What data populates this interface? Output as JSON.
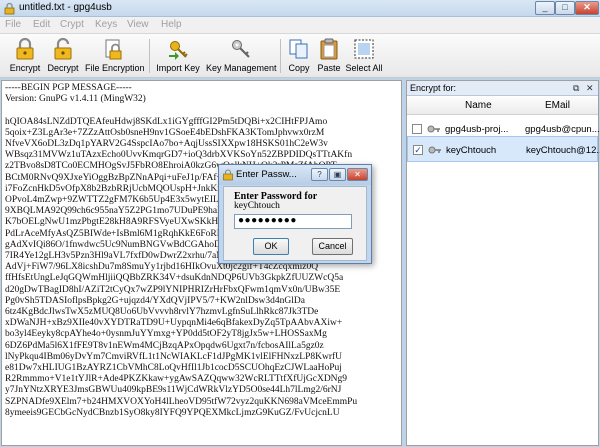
{
  "window": {
    "title": "untitled.txt - gpg4usb"
  },
  "menu": [
    "File",
    "Edit",
    "Crypt",
    "Keys",
    "View",
    "Help"
  ],
  "toolbar": {
    "encrypt": "Encrypt",
    "decrypt": "Decrypt",
    "file_encryption": "File Encryption",
    "import_key": "Import Key",
    "key_management": "Key Management",
    "copy": "Copy",
    "paste": "Paste",
    "select_all": "Select All"
  },
  "editor": {
    "lines": [
      "-----BEGIN PGP MESSAGE-----",
      "Version: GnuPG v1.4.11 (MingW32)",
      "",
      "hQIOA84sLNZdDTQEAfeuHdwj8SKdLx1iGYgfffGI2Pm5tDQBi+x2CIHtFPJAmo",
      "5qoix+Z3LgAr3e+7ZZzAttOsb0sneH9nv1GSoeE4bEDshFKA3KTomJphvwx0rzM",
      "NfveVX6oDL3zDq1pYARV2G4SspcIAo7bo+AqjUssSIXXpw18HSKS01hC2eW3v",
      "WBsqz31MVWz1uTAzxEcho0UvvKmqrGD7+ioQ3drbXVKSoYn52ZBPDIDQsTTtAKfn",
      "z2TBvo8sD8TCo0ECMHOgSvJ5FbRO8EhroiA0kzG6wOolkNH+Ok2rPMsZfAbQPT",
      "BCtM0RNvQ9XJxeYiOggBzBpZNnAPqi+uFeJ1p/FAf+M/YxHmHSJzhhrG6tvVKpI",
      "i7FoZcnHkD5vOfpX8b2BzbRRjUcbMQOUspH+JnkKrwVtpIEoc5Wfl2SiK9sr1mTS",
      "OPvoL4mZwp+9ZWTTZ2gFM7K6b5Up4E3x5wytEILS1sQqE5Dm0hkN3Yb1cRA",
      "9XBQLMA92Q99ch6c955naY5Z2PG1mo7UDuPE9haBHD05ri0Bja27VkFcRCs",
      "K7bOELgNwU1mzPbgtE28kH8A9RFSVyeUXwSKkHDE04PTn1T0nRfFmTXKNQ",
      "PdLrAceMfyAsQZ5BIWde+IsBml6M1gRqhKkE6FoRHrL5Jc8vNdmpN1hIfh4d",
      "gAdXvIQi86O/1fnwdwc5Uc9NumBNGVwBdCGAhoDWg2r1P1v+WrSUOpH4ls",
      "7IR4Ye12gLH3v5Pzn3Hl9aVL7fxfD0wDwrZ2xrhu/7aMcmqqqHPs2FymyHFR",
      "AdVj+FiW7/96LX8icshDu7m8SmuYy1rjbd16HIkOvuXt0jc2gif+T4cZcqxmiz0Q",
      "ffHfsEtUngLeJqGQWmHljiiQQBbZRK34V+dsuKdnNDQP6UVb3GkpkZfUUZWcQ5a",
      "d20gDwTBagID8hI/AZiT2tCyQx7wZP9lYNIPHRIZrHrFbxQFwm1qmVx0n/UBw35E",
      "Pg0vSh5TDASIoflpsBpkg2G+ujqzd4/YXdQVjIPV5/7+KW2nlDsw3d4nGlDa",
      "6tz4KgBdcJlwsTwX5zMUQ8Uo6UbVvvvh8rvlY7hzmvLgfnSuLlhRkc87Jk3TDe",
      "xDWaNJH+xBz9XIIe40vXYDTRaTD9U+UypqnMi4e6qBfakexDyZq5TpAAbvAXiw+",
      "bo3yl4Eeyky8cpAYhe4o+0ysnmJuYYmxg+YP0dd5tOF2yT8jgJx5w+LHOSSaxMg",
      "6DZ6PdMa5l6X1fFE9T8v1nEWm4MCjBzqAPxOpqdw6Ugxt7n/fcbosAIlLa5gz0z",
      "lNyPkqu4IBm06yDvYm7CmviRVfL1t1NcWIAKLcF1dJPgMK1vlElFHNxzLP8KwrfU",
      "e81Dw7xHLIUG1BzAYRZ1CbVMhC8LoQvHfIl1Jb1cocD5SCUOhqEzCJWLaaHoPuj",
      "R2Rmmmo+V1e1tYJlR+Ade4PKZKkaw+ygAwSAZQqww32WcRLTTtfXfUjGcXDNg9",
      "y7JnYNtzXRYE3JmsGBWUu409kpBE9s11WjCdWRkVlzYD5O0se44Lh7lLmg2/6rNJ",
      "SZPNADfe9XElm7+b24HMXVOXYoH4lLheoVD95tfW72vyz2quKKN698aVMceEmmPu",
      "8ymeeis9GECbGcNydCBnzb1SyO8ky8IYFQ9YPQEXMkcLjmzG9KuGZ/FvUcjcnLU"
    ]
  },
  "keys_panel": {
    "title": "Encrypt for:",
    "columns": {
      "name": "Name",
      "email": "EMail"
    },
    "rows": [
      {
        "name": "gpg4usb-proj...",
        "email": "gpg4usb@cpun...",
        "checked": false
      },
      {
        "name": "keyChtouch",
        "email": "keyChtouch@12...",
        "checked": true
      }
    ]
  },
  "dialog": {
    "title": "Enter Passw...",
    "prompt": "Enter Password for",
    "user_id": "keyChtouch",
    "password_mask": "●●●●●●●●●",
    "ok": "OK",
    "cancel": "Cancel"
  }
}
